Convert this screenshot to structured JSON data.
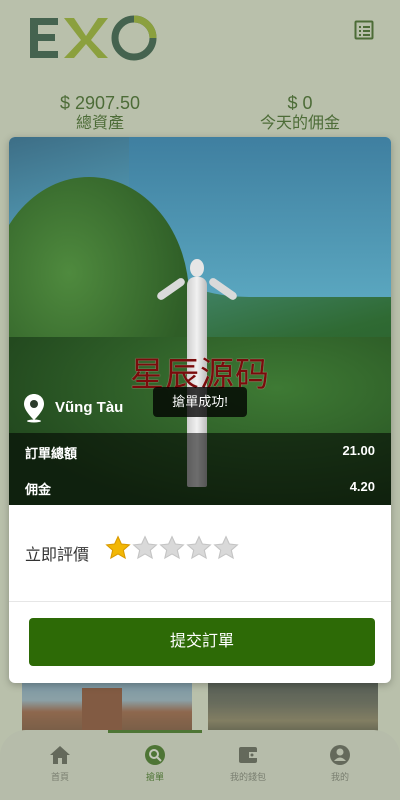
{
  "header": {
    "logo_text": "EXO",
    "menu_icon": "list-icon"
  },
  "stats": {
    "total_assets_value": "$ 2907.50",
    "total_assets_label": "總資產",
    "today_commission_value": "$ 0",
    "today_commission_label": "今天的佣金"
  },
  "modal": {
    "watermark": "星辰源码",
    "location_name": "Vũng Tàu",
    "toast": "搶單成功!",
    "order_total_label": "訂單總額",
    "order_total_value": "21.00",
    "commission_label": "佣金",
    "commission_value": "4.20",
    "rating_label": "立即評價",
    "rating_value": 1,
    "rating_max": 5,
    "submit_label": "提交訂單"
  },
  "tabbar": {
    "items": [
      {
        "label": "首頁",
        "icon": "home-icon"
      },
      {
        "label": "搶單",
        "icon": "grab-order-icon"
      },
      {
        "label": "我的錢包",
        "icon": "wallet-icon"
      },
      {
        "label": "我的",
        "icon": "user-icon"
      }
    ],
    "active_index": 1
  },
  "colors": {
    "primary": "#2d6a06",
    "star_active": "#f2b705",
    "star_inactive": "#d9d9d9"
  }
}
